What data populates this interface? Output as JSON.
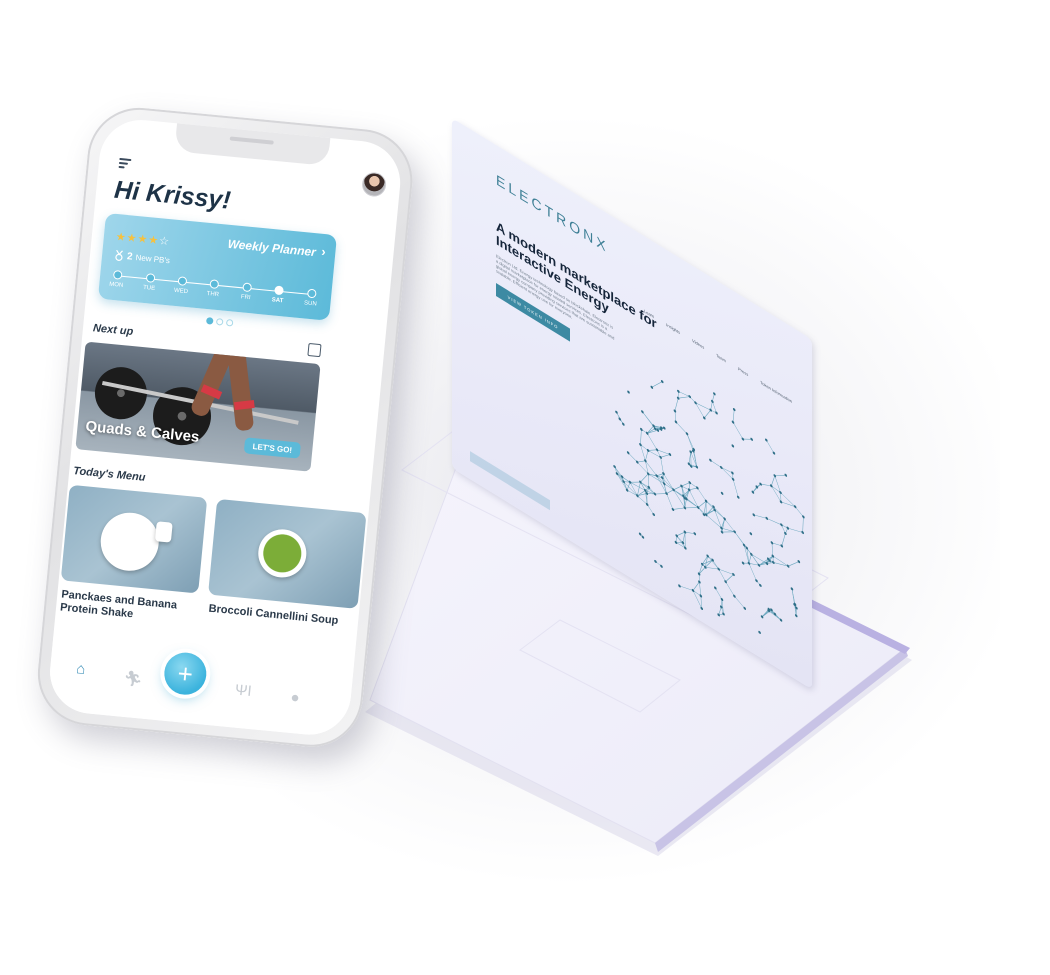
{
  "phone": {
    "greeting": "Hi Krissy!",
    "planner": {
      "title": "Weekly Planner",
      "rating": 4,
      "rating_max": 5,
      "pb_count": "2",
      "pb_label": "New PB's",
      "days": [
        "MON",
        "TUE",
        "WED",
        "THR",
        "FRI",
        "SAT",
        "SUN"
      ],
      "active_day": "SAT"
    },
    "next_up": {
      "heading": "Next up",
      "workout_title": "Quads & Calves",
      "cta": "LET'S GO!"
    },
    "menu": {
      "heading": "Today's Menu",
      "items": [
        {
          "name": "Panckaes and Banana Protein Shake"
        },
        {
          "name": "Broccoli Cannellini Soup"
        }
      ]
    },
    "tabbar": {
      "icons": [
        "home-icon",
        "run-icon",
        "add-icon",
        "cutlery-icon",
        "chat-icon"
      ],
      "fab_label": "+"
    }
  },
  "laptop": {
    "brand": "ELECTRONX",
    "nav": [
      "Learn",
      "Insights",
      "Videos",
      "Team",
      "Press",
      "Token Information"
    ],
    "hero_title": "A modern marketplace for Interactive Energy",
    "hero_body": "Electron Ltd. Energy technology based on blockchain. Electronx is a digital marketplace for energy related services. Electrons is a global energy company providing services that are sustainable and scalable. Efficient energy use for everyone.",
    "cta": "VIEW TOKEN INFO"
  },
  "colors": {
    "accent": "#5cbad9",
    "brand_teal": "#3d7f95",
    "text_dark": "#1e3347",
    "star": "#f6c13e"
  }
}
